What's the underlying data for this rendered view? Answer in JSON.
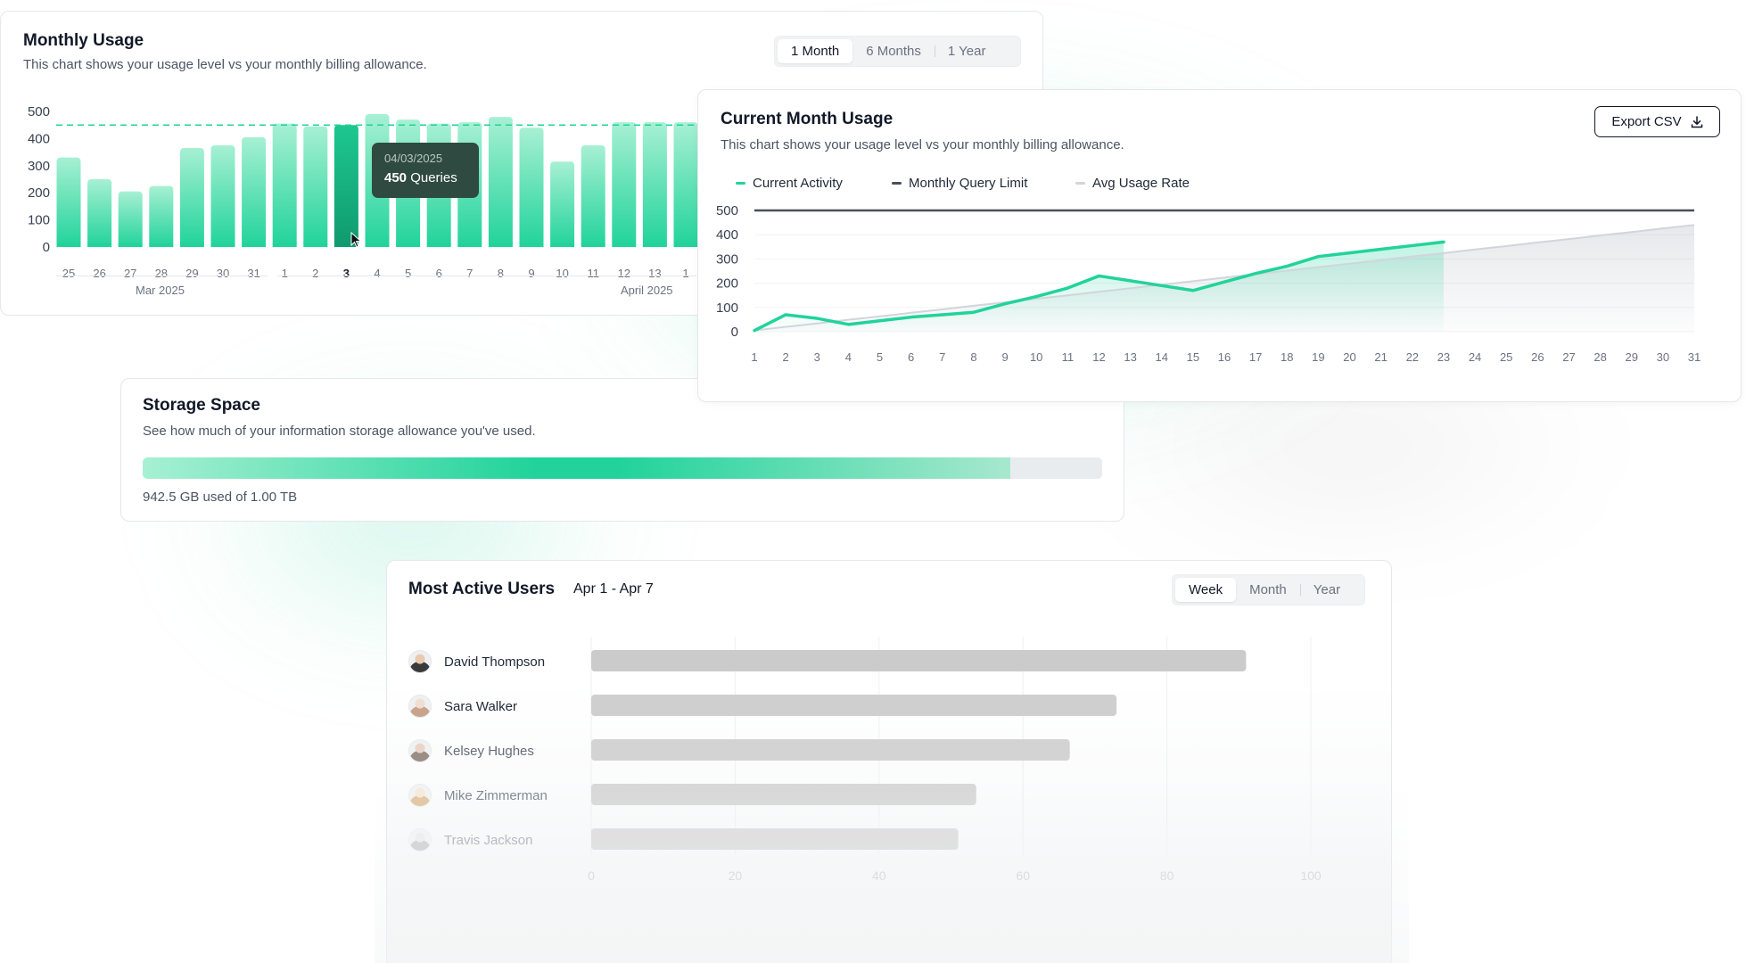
{
  "colors": {
    "accent": "#21d39a",
    "accent_dark": "#0f9a6e",
    "limit_line": "#4b4f56",
    "avg_line": "#d1d5db",
    "tooltip_bg": "#2f4a41"
  },
  "monthly_usage": {
    "title": "Monthly Usage",
    "subtitle": "This chart shows your usage level vs your monthly billing allowance.",
    "ranges": [
      "1 Month",
      "6 Months",
      "1 Year"
    ],
    "active_range": "1 Month",
    "month_labels": [
      "Mar 2025",
      "April 2025"
    ],
    "tooltip": {
      "date": "04/03/2025",
      "value": "450",
      "unit": "Queries"
    }
  },
  "current_month": {
    "title": "Current Month Usage",
    "subtitle": "This chart shows your usage level vs your monthly billing allowance.",
    "export_label": "Export CSV",
    "export_icon": "download-icon",
    "legend": [
      "Current Activity",
      "Monthly Query Limit",
      "Avg Usage Rate"
    ]
  },
  "storage": {
    "title": "Storage Space",
    "subtitle": "See how much of your information storage allowance you've used.",
    "used_text": "942.5 GB used of 1.00 TB",
    "fill_fraction": 0.904
  },
  "active_users": {
    "title": "Most Active Users",
    "date_range": "Apr 1 - Apr 7",
    "ranges": [
      "Week",
      "Month",
      "Year"
    ],
    "active_range": "Week",
    "users": [
      {
        "name": "David Thompson",
        "value": 91
      },
      {
        "name": "Sara Walker",
        "value": 73
      },
      {
        "name": "Kelsey Hughes",
        "value": 66.5
      },
      {
        "name": "Mike Zimmerman",
        "value": 53.5
      },
      {
        "name": "Travis Jackson",
        "value": 51
      }
    ],
    "x_ticks": [
      "0",
      "20",
      "40",
      "60",
      "80",
      "100"
    ]
  },
  "chart_data": [
    {
      "type": "bar",
      "title": "Monthly Usage",
      "categories": [
        "25",
        "26",
        "27",
        "28",
        "29",
        "30",
        "31",
        "1",
        "2",
        "3",
        "4",
        "5",
        "6",
        "7",
        "8",
        "9",
        "10",
        "11",
        "12",
        "13",
        "1"
      ],
      "values": [
        330,
        250,
        205,
        225,
        365,
        375,
        405,
        455,
        445,
        450,
        490,
        470,
        455,
        460,
        480,
        440,
        315,
        375,
        460,
        460,
        460
      ],
      "highlighted_category": "3",
      "allowance": 450,
      "ylim": [
        0,
        500
      ],
      "yticks": [
        "500",
        "400",
        "300",
        "200",
        "100",
        "0"
      ]
    },
    {
      "type": "line",
      "title": "Current Month Usage",
      "x": [
        "1",
        "2",
        "3",
        "4",
        "5",
        "6",
        "7",
        "8",
        "9",
        "10",
        "11",
        "12",
        "13",
        "14",
        "15",
        "16",
        "17",
        "18",
        "19",
        "20",
        "21",
        "22",
        "23",
        "24",
        "25",
        "26",
        "27",
        "28",
        "29",
        "30",
        "31"
      ],
      "series": [
        {
          "name": "Current Activity",
          "values": [
            5,
            70,
            55,
            30,
            45,
            60,
            70,
            80,
            115,
            145,
            180,
            230,
            210,
            190,
            170,
            205,
            240,
            270,
            310,
            325,
            340,
            355,
            370
          ]
        },
        {
          "name": "Monthly Query Limit",
          "values": [
            500,
            500,
            500,
            500,
            500,
            500,
            500,
            500,
            500,
            500,
            500,
            500,
            500,
            500,
            500,
            500,
            500,
            500,
            500,
            500,
            500,
            500,
            500,
            500,
            500,
            500,
            500,
            500,
            500,
            500,
            500
          ]
        },
        {
          "name": "Avg Usage Rate",
          "values": [
            5,
            20,
            34,
            49,
            63,
            78,
            92,
            107,
            121,
            136,
            150,
            165,
            179,
            194,
            208,
            223,
            237,
            252,
            266,
            281,
            295,
            310,
            324,
            339,
            353,
            368,
            382,
            397,
            411,
            426,
            440
          ]
        }
      ],
      "ylim": [
        0,
        500
      ],
      "yticks": [
        "500",
        "400",
        "300",
        "200",
        "100",
        "0"
      ]
    },
    {
      "type": "bar",
      "title": "Most Active Users",
      "categories": [
        "David Thompson",
        "Sara Walker",
        "Kelsey Hughes",
        "Mike Zimmerman",
        "Travis Jackson"
      ],
      "values": [
        91,
        73,
        66.5,
        53.5,
        51
      ],
      "xlim": [
        0,
        100
      ]
    }
  ]
}
